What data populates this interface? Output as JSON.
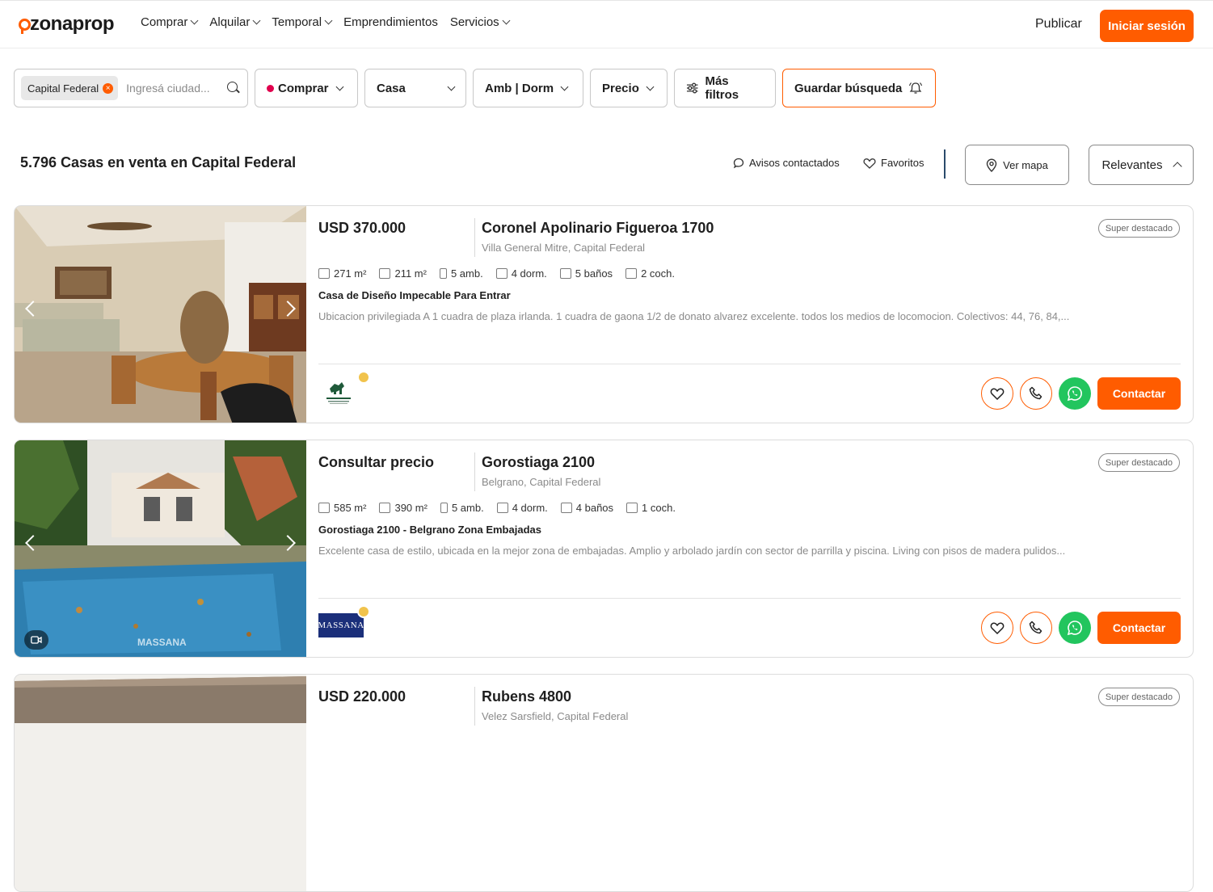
{
  "brand": {
    "name": "zonaprop",
    "accent": "#ff5c00"
  },
  "nav": [
    {
      "label": "Comprar"
    },
    {
      "label": "Alquilar"
    },
    {
      "label": "Temporal"
    },
    {
      "label": "Emprendimientos"
    },
    {
      "label": "Servicios"
    }
  ],
  "header": {
    "publish_label": "Publicar",
    "login_label": "Iniciar sesión"
  },
  "filters": {
    "location_chip": "Capital Federal",
    "search_placeholder": "Ingresá ciudad...",
    "operation": "Comprar",
    "property_type": "Casa",
    "rooms": "Amb | Dorm",
    "price": "Precio",
    "more": "Más filtros",
    "save_search": "Guardar búsqueda"
  },
  "results": {
    "title": "5.796 Casas en venta en Capital Federal",
    "contacted_label": "Avisos contactados",
    "favorites_label": "Favoritos",
    "map_label": "Ver mapa",
    "sort_label": "Relevantes"
  },
  "listings": [
    {
      "price": "USD 370.000",
      "address": "Coronel Apolinario Figueroa 1700",
      "location": "Villa General Mitre, Capital Federal",
      "badge": "Super destacado",
      "features": {
        "total_area": "271 m²",
        "covered_area": "211 m²",
        "rooms": "5 amb.",
        "bedrooms": "4 dorm.",
        "bathrooms": "5 baños",
        "parking": "2 coch."
      },
      "title": "Casa de Diseño Impecable Para Entrar",
      "description": "Ubicacion privilegiada A 1 cuadra de plaza irlanda. 1 cuadra de gaona 1/2 de donato alvarez excelente. todos los medios de locomocion. Colectivos: 44, 76, 84,...",
      "contact_label": "Contactar"
    },
    {
      "price": "Consultar precio",
      "address": "Gorostiaga 2100",
      "location": "Belgrano, Capital Federal",
      "badge": "Super destacado",
      "features": {
        "total_area": "585 m²",
        "covered_area": "390 m²",
        "rooms": "5 amb.",
        "bedrooms": "4 dorm.",
        "bathrooms": "4 baños",
        "parking": "1 coch."
      },
      "title": "Gorostiaga 2100 - Belgrano Zona Embajadas",
      "description": "Excelente casa de estilo, ubicada en la mejor zona de embajadas. Amplio y arbolado jardín con sector de parrilla y piscina. Living con pisos de madera pulidos...",
      "agency_name": "MASSANA",
      "contact_label": "Contactar"
    },
    {
      "price": "USD 220.000",
      "address": "Rubens 4800",
      "location": "Velez Sarsfield, Capital Federal",
      "badge": "Super destacado"
    }
  ]
}
